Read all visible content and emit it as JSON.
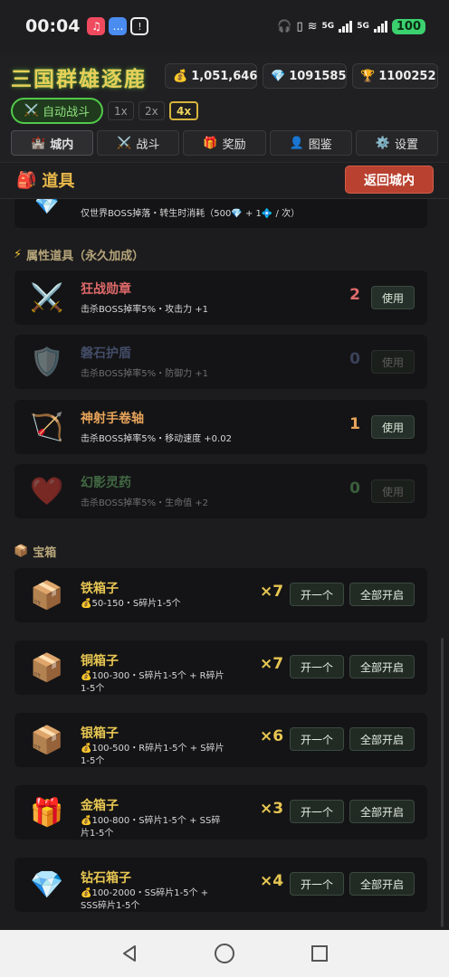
{
  "status_bar": {
    "time": "00:04",
    "signal1": "5G",
    "signal2": "5G",
    "battery": "100"
  },
  "header": {
    "title": "三国群雄逐鹿",
    "gold": "1,051,646",
    "diamond": "1091585",
    "trophy": "1100252",
    "auto_battle": "自动战斗",
    "speeds": [
      "1x",
      "2x",
      "4x"
    ],
    "active_speed": "4x",
    "tabs": [
      {
        "label": "城内",
        "icon": "castle-icon"
      },
      {
        "label": "战斗",
        "icon": "swords-icon"
      },
      {
        "label": "奖励",
        "icon": "gift-icon"
      },
      {
        "label": "图鉴",
        "icon": "person-icon"
      },
      {
        "label": "设置",
        "icon": "gear-icon"
      }
    ]
  },
  "bag": {
    "title": "道具",
    "back_button": "返回城内",
    "partial_desc": "仅世界BOSS掉落・转生时消耗（500💎 + 1💠 / 次）",
    "attr_section": "属性道具（永久加成）",
    "attr_items": [
      {
        "name": "狂战勋章",
        "desc": "击杀BOSS掉率5%・攻击力 +1",
        "count": "2",
        "use": "使用",
        "icon": "crossed-swords-icon",
        "color": "#e06a6a",
        "count_color": "#e06a6a",
        "dim": false
      },
      {
        "name": "磐石护盾",
        "desc": "击杀BOSS掉率5%・防御力 +1",
        "count": "0",
        "use": "使用",
        "icon": "shield-icon",
        "color": "#7a90c8",
        "count_color": "#6a7aa8",
        "dim": true
      },
      {
        "name": "神射手卷轴",
        "desc": "击杀BOSS掉率5%・移动速度 +0.02",
        "count": "1",
        "use": "使用",
        "icon": "bow-icon",
        "color": "#e8a45a",
        "count_color": "#e8a45a",
        "dim": false
      },
      {
        "name": "幻影灵药",
        "desc": "击杀BOSS掉率5%・生命值 +2",
        "count": "0",
        "use": "使用",
        "icon": "heart-icon",
        "color": "#7ad07a",
        "count_color": "#6ab86a",
        "dim": true
      }
    ],
    "chest_section": "宝箱",
    "chests": [
      {
        "name": "铁箱子",
        "desc": "💰50-150・S碎片1-5个",
        "count": "×7",
        "open_one": "开一个",
        "open_all": "全部开启",
        "icon": "box-icon"
      },
      {
        "name": "铜箱子",
        "desc": "💰100-300・S碎片1-5个 + R碎片1-5个",
        "count": "×7",
        "open_one": "开一个",
        "open_all": "全部开启",
        "icon": "box-icon"
      },
      {
        "name": "银箱子",
        "desc": "💰100-500・R碎片1-5个 + S碎片1-5个",
        "count": "×6",
        "open_one": "开一个",
        "open_all": "全部开启",
        "icon": "box-icon"
      },
      {
        "name": "金箱子",
        "desc": "💰100-800・S碎片1-5个 + SS碎片1-5个",
        "count": "×3",
        "open_one": "开一个",
        "open_all": "全部开启",
        "icon": "gift-box-icon"
      },
      {
        "name": "钻石箱子",
        "desc": "💰100-2000・SS碎片1-5个 + SSS碎片1-5个",
        "count": "×4",
        "open_one": "开一个",
        "open_all": "全部开启",
        "icon": "diamond-icon"
      }
    ]
  }
}
